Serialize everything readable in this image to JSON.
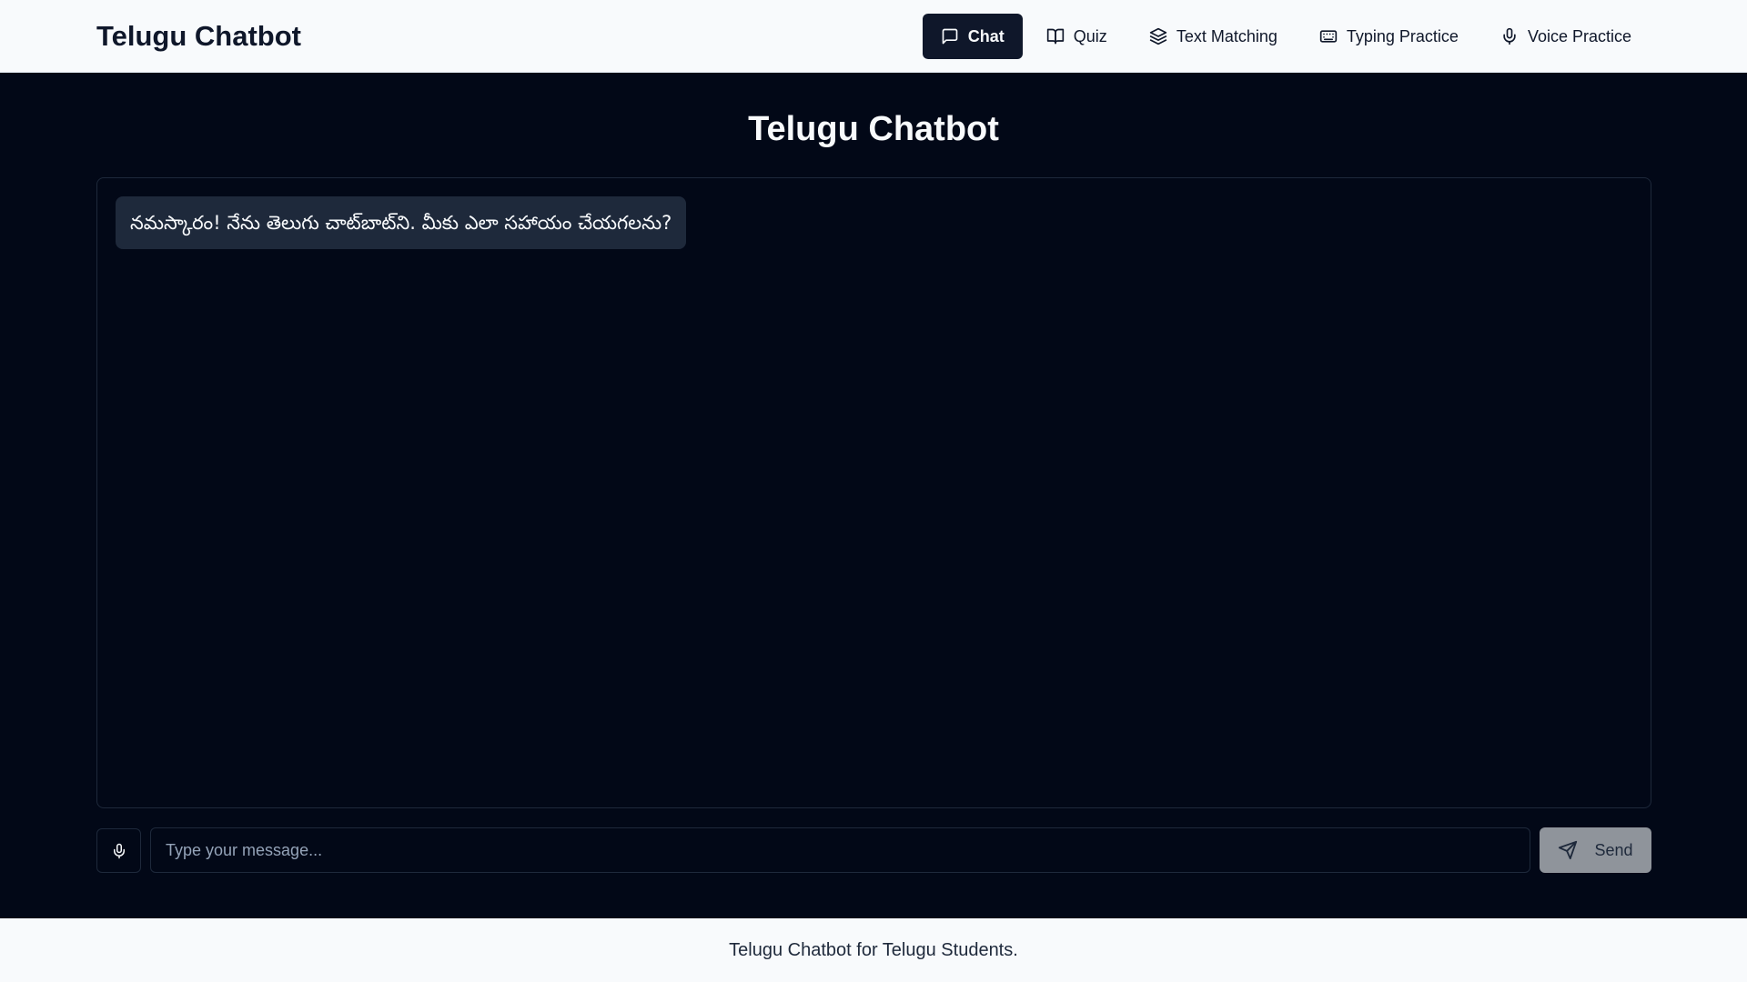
{
  "header": {
    "brand": "Telugu Chatbot",
    "nav": [
      {
        "label": "Chat",
        "icon": "message-square-icon",
        "active": true
      },
      {
        "label": "Quiz",
        "icon": "book-open-icon",
        "active": false
      },
      {
        "label": "Text Matching",
        "icon": "layers-icon",
        "active": false
      },
      {
        "label": "Typing Practice",
        "icon": "keyboard-icon",
        "active": false
      },
      {
        "label": "Voice Practice",
        "icon": "mic-icon",
        "active": false
      }
    ]
  },
  "main": {
    "title": "Telugu Chatbot",
    "messages": [
      {
        "sender": "bot",
        "text": "నమస్కారం! నేను తెలుగు చాట్‌బాట్‌ని. మీకు ఎలా సహాయం చేయగలను?"
      }
    ]
  },
  "input": {
    "mic_icon": "mic-icon",
    "placeholder": "Type your message...",
    "value": "",
    "send_label": "Send",
    "send_icon": "send-icon"
  },
  "footer": {
    "text": "Telugu Chatbot for Telugu Students."
  },
  "colors": {
    "background": "#020817",
    "header_bg": "#f8fafc",
    "active_tab_bg": "#0f172a",
    "bubble_bg": "#1e293b",
    "send_button_bg": "#8f949b"
  }
}
